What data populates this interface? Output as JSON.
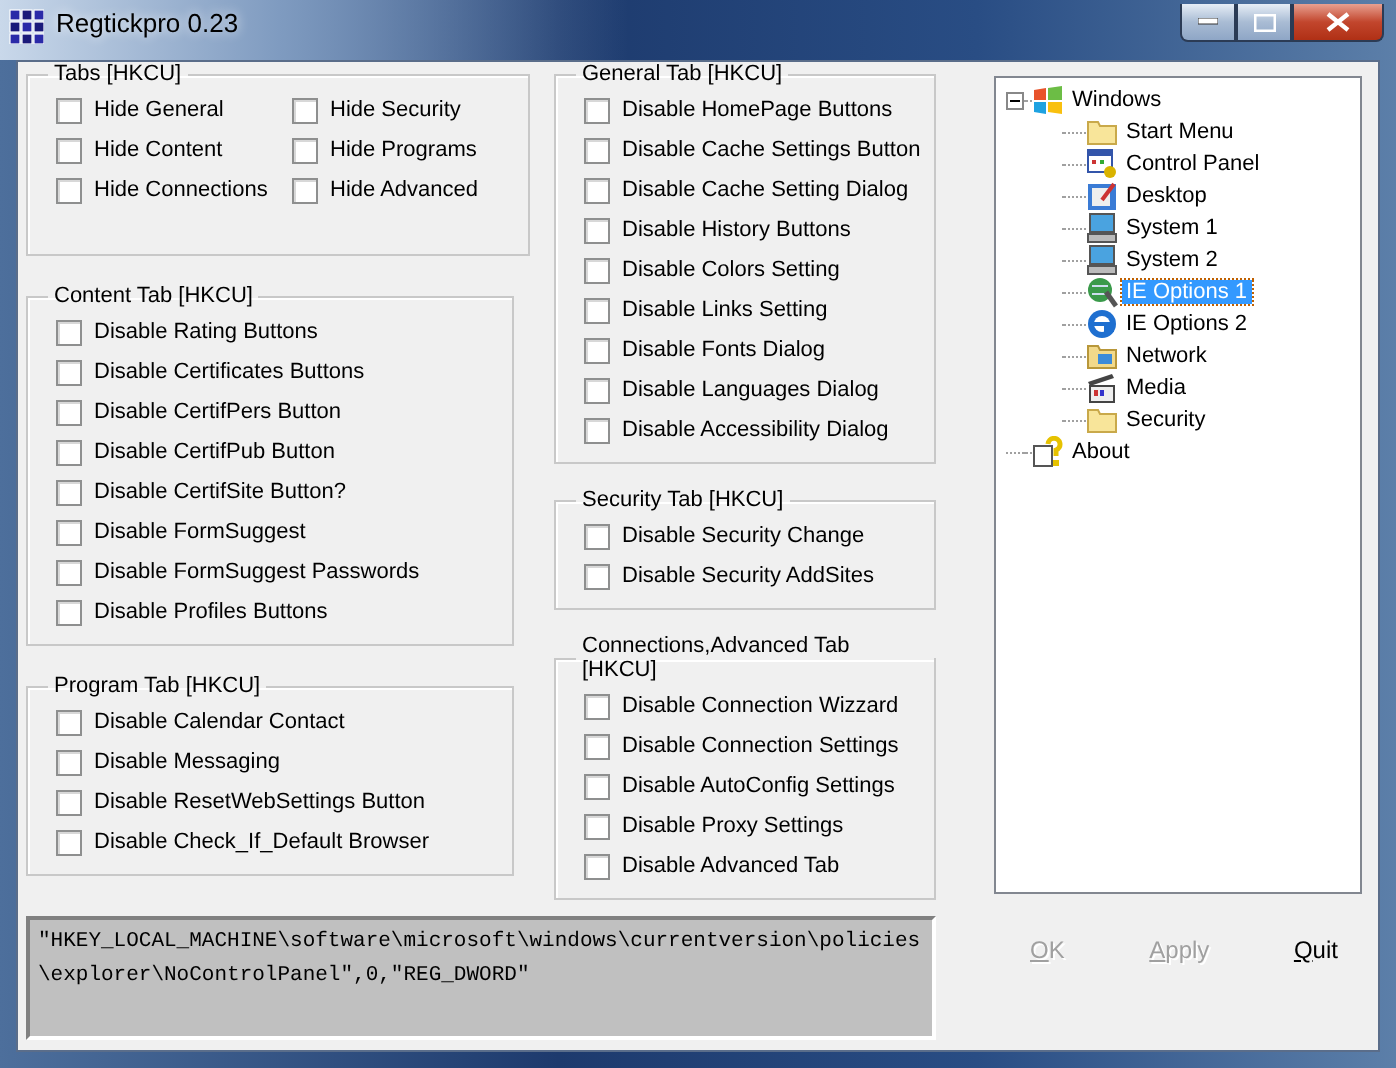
{
  "window": {
    "title": "Regtickpro 0.23"
  },
  "left_column": {
    "groups": [
      {
        "title": "Tabs [HKCU]",
        "rows": [
          [
            {
              "label": "Hide General",
              "checked": false
            },
            {
              "label": "Hide Security",
              "checked": false
            }
          ],
          [
            {
              "label": "Hide Content",
              "checked": false
            },
            {
              "label": "Hide Programs",
              "checked": false
            }
          ],
          [
            {
              "label": "Hide Connections",
              "checked": false
            },
            {
              "label": "Hide Advanced",
              "checked": false
            }
          ]
        ]
      },
      {
        "title": "Content Tab [HKCU]",
        "rows": [
          [
            {
              "label": "Disable Rating Buttons",
              "checked": false
            }
          ],
          [
            {
              "label": "Disable Certificates Buttons",
              "checked": false
            }
          ],
          [
            {
              "label": "Disable CertifPers Button",
              "checked": false
            }
          ],
          [
            {
              "label": "Disable CertifPub Button",
              "checked": false
            }
          ],
          [
            {
              "label": "Disable CertifSite Button?",
              "checked": false
            }
          ],
          [
            {
              "label": "Disable FormSuggest",
              "checked": false
            }
          ],
          [
            {
              "label": "Disable FormSuggest Passwords",
              "checked": false
            }
          ],
          [
            {
              "label": "Disable Profiles Buttons",
              "checked": false
            }
          ]
        ]
      },
      {
        "title": "Program Tab [HKCU]",
        "rows": [
          [
            {
              "label": "Disable Calendar Contact",
              "checked": false
            }
          ],
          [
            {
              "label": "Disable Messaging",
              "checked": false
            }
          ],
          [
            {
              "label": "Disable ResetWebSettings Button",
              "checked": false
            }
          ],
          [
            {
              "label": "Disable Check_If_Default Browser",
              "checked": false
            }
          ]
        ]
      }
    ]
  },
  "middle_column": {
    "groups": [
      {
        "title": "General Tab [HKCU]",
        "rows": [
          [
            {
              "label": "Disable HomePage Buttons",
              "checked": false
            }
          ],
          [
            {
              "label": "Disable Cache Settings Button",
              "checked": false
            }
          ],
          [
            {
              "label": "Disable Cache Setting Dialog",
              "checked": false
            }
          ],
          [
            {
              "label": "Disable History Buttons",
              "checked": false
            }
          ],
          [
            {
              "label": "Disable Colors Setting",
              "checked": false
            }
          ],
          [
            {
              "label": "Disable Links Setting",
              "checked": false
            }
          ],
          [
            {
              "label": "Disable Fonts Dialog",
              "checked": false
            }
          ],
          [
            {
              "label": "Disable Languages Dialog",
              "checked": false
            }
          ],
          [
            {
              "label": "Disable Accessibility Dialog",
              "checked": false
            }
          ]
        ]
      },
      {
        "title": "Security Tab [HKCU]",
        "rows": [
          [
            {
              "label": "Disable Security Change",
              "checked": false
            }
          ],
          [
            {
              "label": "Disable Security AddSites",
              "checked": false
            }
          ]
        ]
      },
      {
        "title": "Connections,Advanced Tab [HKCU]",
        "rows": [
          [
            {
              "label": "Disable Connection Wizzard",
              "checked": false
            }
          ],
          [
            {
              "label": "Disable Connection Settings",
              "checked": false
            }
          ],
          [
            {
              "label": "Disable AutoConfig Settings",
              "checked": false
            }
          ],
          [
            {
              "label": "Disable Proxy Settings",
              "checked": false
            }
          ],
          [
            {
              "label": "Disable Advanced Tab",
              "checked": false
            }
          ]
        ]
      }
    ]
  },
  "registry_output": {
    "lines": [
      "\"HKEY_LOCAL_MACHINE\\software\\microsoft\\windows\\currentversion\\policies",
      "\\explorer\\NoControlPanel\",0,\"REG_DWORD\""
    ]
  },
  "tree": [
    {
      "label": "Windows",
      "kind": "windows",
      "selected": false,
      "expanded": true,
      "children": [
        {
          "label": "Start Menu",
          "kind": "folder",
          "selected": false
        },
        {
          "label": "Control Panel",
          "kind": "control-panel",
          "selected": false
        },
        {
          "label": "Desktop",
          "kind": "desktop",
          "selected": false
        },
        {
          "label": "System 1",
          "kind": "computer",
          "selected": false
        },
        {
          "label": "System 2",
          "kind": "computer",
          "selected": false
        },
        {
          "label": "IE Options 1",
          "kind": "ie-tools",
          "selected": true
        },
        {
          "label": "IE Options 2",
          "kind": "ie",
          "selected": false
        },
        {
          "label": "Network",
          "kind": "network",
          "selected": false
        },
        {
          "label": "Media",
          "kind": "media",
          "selected": false
        },
        {
          "label": "Security",
          "kind": "folder",
          "selected": false
        }
      ]
    },
    {
      "label": "About",
      "kind": "about",
      "selected": false
    }
  ],
  "buttons": [
    {
      "label": "OK",
      "disabled": true
    },
    {
      "label": "Apply",
      "disabled": true
    },
    {
      "label": "Quit",
      "disabled": false
    }
  ]
}
